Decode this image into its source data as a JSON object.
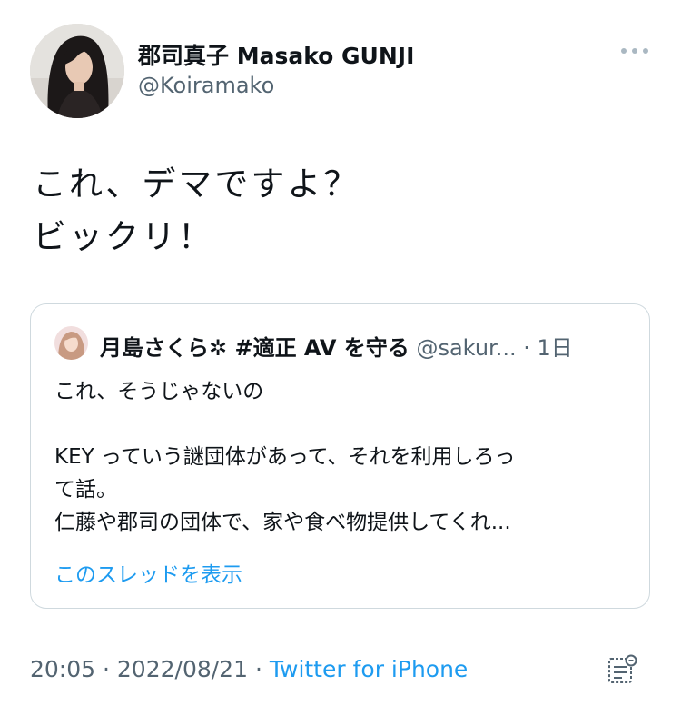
{
  "author": {
    "display_name": "郡司真子 Masako GUNJI",
    "handle": "@Koiramako"
  },
  "tweet": {
    "lines": [
      "これ、デマですよ？",
      "ビックリ！"
    ]
  },
  "quote": {
    "display_name": "月島さくら✲ #適正 AV を守る",
    "handle": "@sakur...",
    "separator": "·",
    "time": "1日",
    "text": {
      "line1": "これ、そうじゃないの",
      "line2": "KEY っていう謎団体があって、それを利用しろっ",
      "line3": "て話。",
      "line4": "仁藤や郡司の団体で、家や食べ物提供してくれ..."
    },
    "show_thread": "このスレッドを表示"
  },
  "meta": {
    "time": "20:05",
    "sep1": "·",
    "date": "2022/08/21",
    "sep2": "·",
    "source": "Twitter for iPhone"
  },
  "colors": {
    "link": "#1d9bf0",
    "muted": "#536471",
    "border": "#cfd9de"
  },
  "icons": {
    "more": "more-icon",
    "analytics": "analytics-icon"
  }
}
